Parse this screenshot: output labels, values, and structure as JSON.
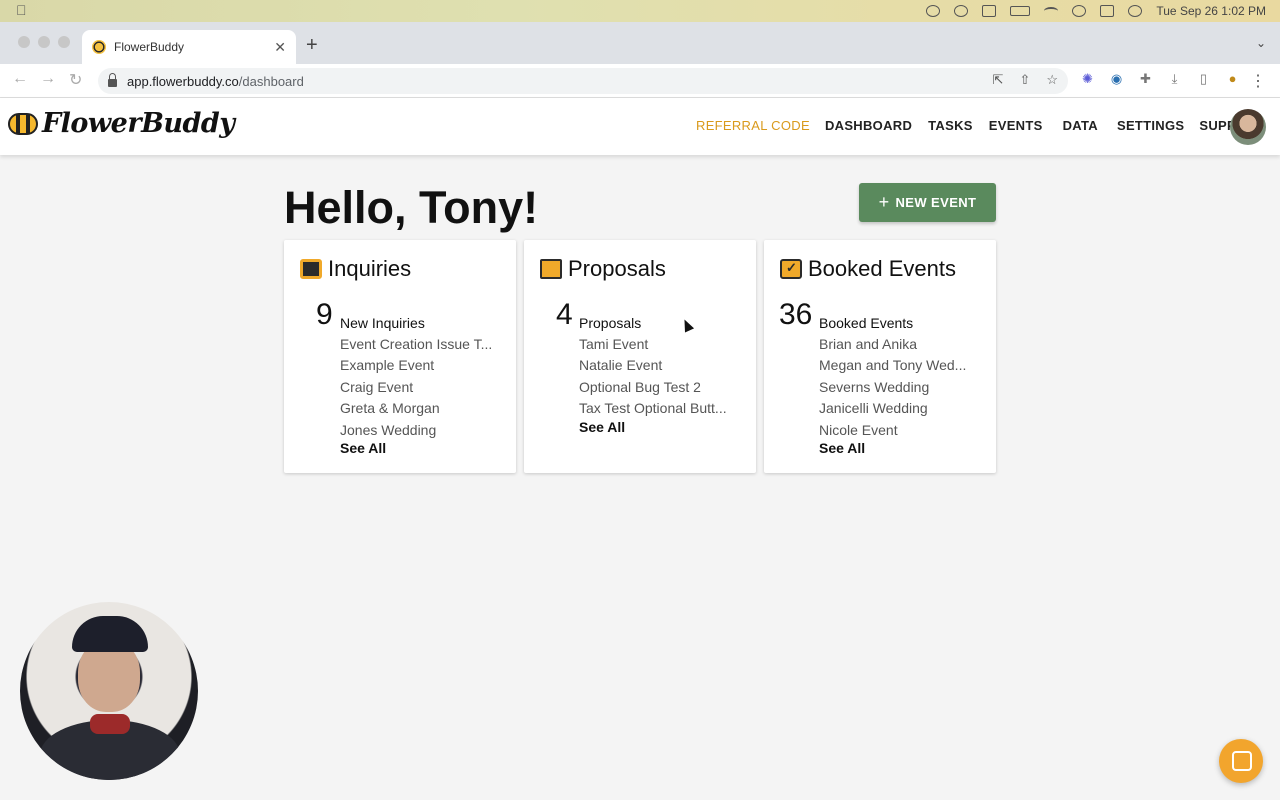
{
  "menubar": {
    "clock": "Tue Sep 26  1:02 PM"
  },
  "browser": {
    "tab_title": "FlowerBuddy",
    "url_host": "app.flowerbuddy.co",
    "url_path": "/dashboard"
  },
  "app": {
    "logo": "FlowerBuddy",
    "nav": {
      "referral": "REFERRAL CODE",
      "dashboard": "DASHBOARD",
      "tasks": "TASKS",
      "events": "EVENTS",
      "data": "DATA",
      "settings": "SETTINGS",
      "support": "SUPPORT"
    },
    "accent_color": "#d99a1c",
    "primary_button_color": "#5a8a5d"
  },
  "main": {
    "greeting": "Hello, Tony!",
    "new_event_label": "NEW EVENT"
  },
  "cards": {
    "inquiries": {
      "title": "Inquiries",
      "icon": "chat-bubbles-icon",
      "count": "9",
      "count_label": "New Inquiries",
      "items": [
        "Event Creation Issue T...",
        "Example Event",
        "Craig Event",
        "Greta & Morgan",
        "Jones Wedding"
      ],
      "see_all": "See All"
    },
    "proposals": {
      "title": "Proposals",
      "icon": "envelope-icon",
      "count": "4",
      "count_label": "Proposals",
      "items": [
        "Tami Event",
        "Natalie Event",
        "Optional Bug Test 2",
        "Tax Test Optional Butt..."
      ],
      "see_all": "See All"
    },
    "booked": {
      "title": "Booked Events",
      "icon": "calendar-check-icon",
      "count": "36",
      "count_label": "Booked Events",
      "items": [
        "Brian and Anika",
        "Megan and Tony Wed...",
        "Severns Wedding",
        "Janicelli Wedding",
        "Nicole Event"
      ],
      "see_all": "See All"
    }
  }
}
